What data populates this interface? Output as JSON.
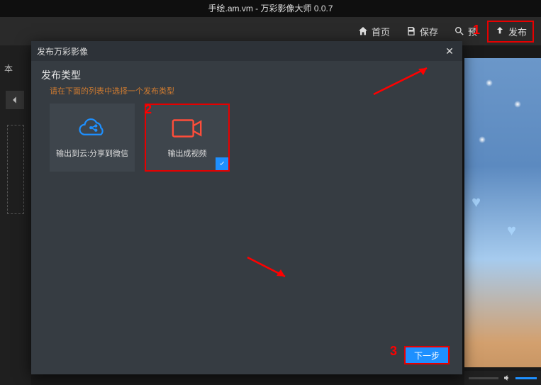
{
  "window": {
    "title": "手绘.am.vm - 万彩影像大师 0.0.7"
  },
  "toolbar": {
    "home_label": "首页",
    "save_label": "保存",
    "preview_label": "预",
    "publish_label": "发布"
  },
  "left": {
    "partial_text": "本"
  },
  "dialog": {
    "title": "发布万彩影像",
    "section_title": "发布类型",
    "subtext": "请在下面的列表中选择一个发布类型",
    "card_cloud_label": "输出到云:分享到微信",
    "card_video_label": "输出成视频",
    "next_label": "下一步"
  },
  "annotations": {
    "n1": "1",
    "n2": "2",
    "n3": "3"
  }
}
